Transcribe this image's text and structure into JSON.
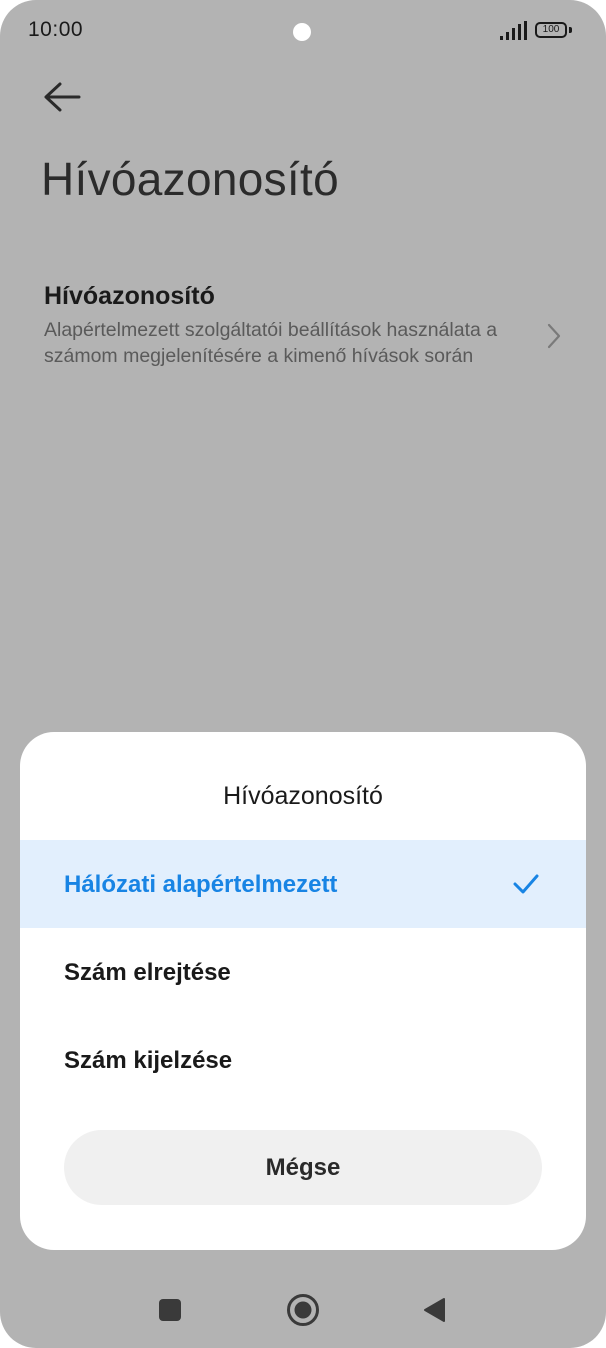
{
  "status_bar": {
    "time": "10:00",
    "battery": "100",
    "icons": [
      "signal-icon",
      "battery-icon"
    ]
  },
  "header": {
    "back_icon": "arrow-left-icon",
    "title": "Hívóazonosító"
  },
  "setting": {
    "title": "Hívóazonosító",
    "description": "Alapértelmezett szolgáltatói beállítások használata a számom megjelenítésére a kimenő hívások során",
    "icon": "chevron-right-icon"
  },
  "dialog": {
    "title": "Hívóazonosító",
    "options": [
      {
        "label": "Hálózati alapértelmezett",
        "selected": true
      },
      {
        "label": "Szám elrejtése",
        "selected": false
      },
      {
        "label": "Szám kijelzése",
        "selected": false
      }
    ],
    "cancel_label": "Mégse"
  },
  "nav_bar": {
    "icons": [
      "recents-square-icon",
      "home-circle-icon",
      "back-triangle-icon"
    ]
  },
  "colors": {
    "scrim": "#b3b3b3",
    "accent": "#1884e4",
    "selected_bg": "#e2effd"
  }
}
